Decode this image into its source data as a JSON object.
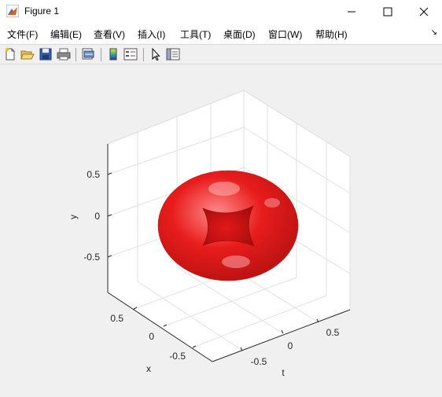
{
  "window": {
    "title": "Figure 1"
  },
  "menu": [
    {
      "label": "文件(F)"
    },
    {
      "label": "编辑(E)"
    },
    {
      "label": "查看(V)"
    },
    {
      "label": "插入(I)"
    },
    {
      "label": "工具(T)"
    },
    {
      "label": "桌面(D)"
    },
    {
      "label": "窗口(W)"
    },
    {
      "label": "帮助(H)"
    }
  ],
  "toolbar": {
    "icons": [
      "new-figure-icon",
      "open-file-icon",
      "save-icon",
      "print-icon",
      "print-preview-icon",
      "colorbar-icon",
      "legend-icon",
      "pointer-icon",
      "property-inspector-icon"
    ]
  },
  "plot": {
    "surface_color": "#e81c1c",
    "y_axis": {
      "label": "y",
      "ticks": [
        "0.5",
        "0",
        "-0.5"
      ]
    },
    "x_axis": {
      "label": "x",
      "ticks": [
        "0.5",
        "0",
        "-0.5"
      ]
    },
    "t_axis": {
      "label": "t",
      "ticks": [
        "0.5",
        "0",
        "-0.5"
      ]
    }
  }
}
